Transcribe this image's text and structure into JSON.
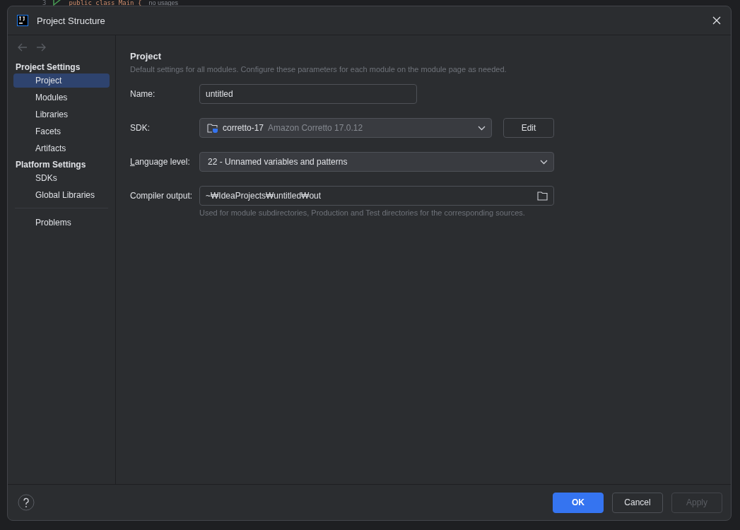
{
  "editor_background": {
    "line_number": "3",
    "code": "public class Main {",
    "hint": "no usages"
  },
  "window": {
    "title": "Project Structure"
  },
  "sidebar": {
    "sections": [
      {
        "title": "Project Settings",
        "items": [
          {
            "label": "Project",
            "selected": true
          },
          {
            "label": "Modules",
            "selected": false
          },
          {
            "label": "Libraries",
            "selected": false
          },
          {
            "label": "Facets",
            "selected": false
          },
          {
            "label": "Artifacts",
            "selected": false
          }
        ]
      },
      {
        "title": "Platform Settings",
        "items": [
          {
            "label": "SDKs",
            "selected": false
          },
          {
            "label": "Global Libraries",
            "selected": false
          }
        ]
      }
    ],
    "footer_items": [
      {
        "label": "Problems",
        "selected": false
      }
    ]
  },
  "content": {
    "heading": "Project",
    "description": "Default settings for all modules. Configure these parameters for each module on the module page as needed.",
    "fields": [
      {
        "kind": "text",
        "label": "Name:",
        "value": "untitled"
      },
      {
        "kind": "sdk",
        "label": "SDK:",
        "value": "corretto-17",
        "detail": "Amazon Corretto 17.0.12",
        "button": "Edit"
      },
      {
        "kind": "dropdown",
        "label": "Language level:",
        "value": "22 - Unnamed variables and patterns"
      },
      {
        "kind": "path",
        "label": "Compiler output:",
        "value": "~₩IdeaProjects₩untitled₩out",
        "hint": "Used for module subdirectories, Production and Test directories for the corresponding sources."
      }
    ]
  },
  "buttons": [
    {
      "label": "OK",
      "kind": "primary",
      "disabled": false
    },
    {
      "label": "Cancel",
      "kind": "default",
      "disabled": false
    },
    {
      "label": "Apply",
      "kind": "default",
      "disabled": true
    }
  ]
}
